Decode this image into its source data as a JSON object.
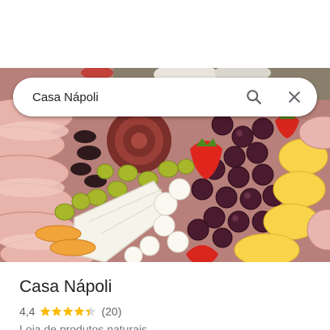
{
  "search": {
    "value": "Casa Nápoli",
    "search_icon": "search-icon",
    "close_icon": "close-icon"
  },
  "photo": {
    "subject": "food-platter-image"
  },
  "place": {
    "name": "Casa Nápoli",
    "rating": "4,4",
    "stars_value": 4.4,
    "stars_max": 5,
    "reviews": "(20)",
    "category": "Loja de produtos naturais"
  },
  "colors": {
    "star": "#fbbc04",
    "star_empty": "#dadce0",
    "text_primary": "#202124",
    "text_secondary": "#70757a"
  }
}
